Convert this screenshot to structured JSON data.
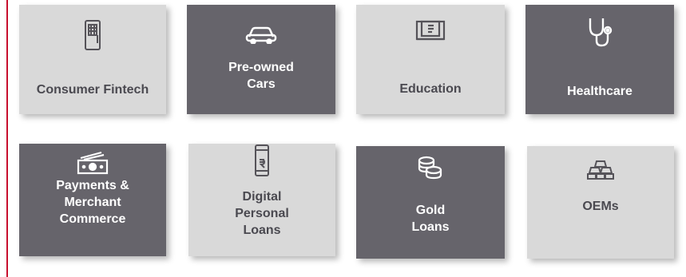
{
  "tiles": [
    {
      "label": "Consumer Fintech",
      "icon": "pos-terminal-icon",
      "theme": "light"
    },
    {
      "label": "Pre-owned\nCars",
      "icon": "car-icon",
      "theme": "dark"
    },
    {
      "label": "Education",
      "icon": "book-icon",
      "theme": "light"
    },
    {
      "label": "Healthcare",
      "icon": "stethoscope-icon",
      "theme": "dark"
    },
    {
      "label": "Payments &\nMerchant\nCommerce",
      "icon": "cash-icon",
      "theme": "dark"
    },
    {
      "label": "Digital\nPersonal\nLoans",
      "icon": "phone-rupee-icon",
      "theme": "light"
    },
    {
      "label": "Gold\nLoans",
      "icon": "coins-icon",
      "theme": "dark"
    },
    {
      "label": "OEMs",
      "icon": "gold-bars-icon",
      "theme": "light"
    }
  ],
  "colors": {
    "accent": "#c8102e",
    "tile_light": "#d9d9d9",
    "tile_dark": "#66646b"
  }
}
